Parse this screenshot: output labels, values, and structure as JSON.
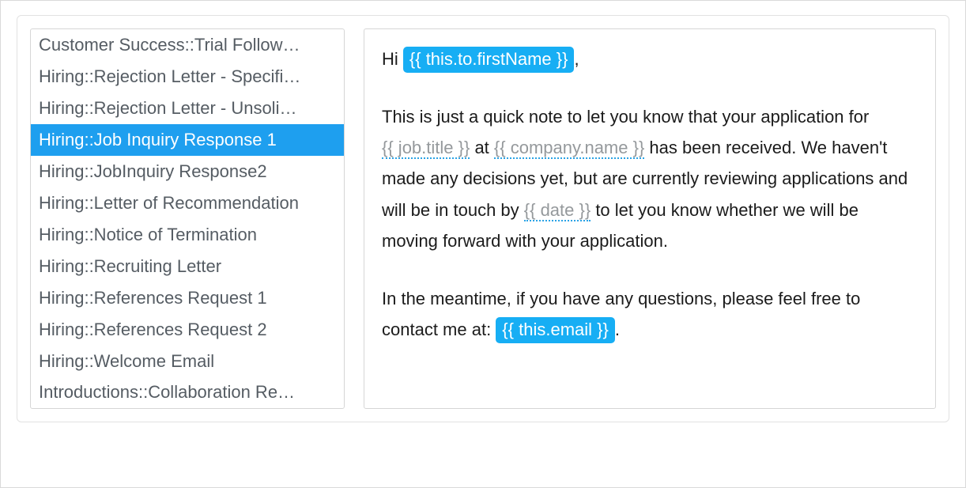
{
  "sidebar": {
    "items": [
      {
        "label": "Customer Success::Trial Follow…",
        "selected": false
      },
      {
        "label": "Hiring::Rejection Letter - Specifi…",
        "selected": false
      },
      {
        "label": "Hiring::Rejection Letter - Unsoli…",
        "selected": false
      },
      {
        "label": "Hiring::Job Inquiry Response 1",
        "selected": true
      },
      {
        "label": "Hiring::JobInquiry Response2",
        "selected": false
      },
      {
        "label": "Hiring::Letter of Recommendation",
        "selected": false
      },
      {
        "label": "Hiring::Notice of Termination",
        "selected": false
      },
      {
        "label": "Hiring::Recruiting Letter",
        "selected": false
      },
      {
        "label": "Hiring::References Request 1",
        "selected": false
      },
      {
        "label": "Hiring::References Request 2",
        "selected": false
      },
      {
        "label": "Hiring::Welcome Email",
        "selected": false
      },
      {
        "label": "Introductions::Collaboration Re…",
        "selected": false
      }
    ]
  },
  "body": {
    "greeting_prefix": "Hi ",
    "tag_firstName": "{{ this.to.firstName }}",
    "greeting_suffix": ",",
    "p1_a": "This is just a quick note to let you know that your application for ",
    "tag_jobTitle": "{{ job.title }}",
    "p1_b": " at ",
    "tag_companyName": "{{ company.name }}",
    "p1_c": " has been received. We haven't made any decisions yet, but are currently reviewing applications and will be in touch by ",
    "tag_date": "{{ date }}",
    "p1_d": " to let you know whether we will be moving forward with your application.",
    "p2_a": "In the meantime, if you have any questions, please feel free to contact me at: ",
    "tag_email": "{{ this.email }}",
    "p2_b": "."
  }
}
